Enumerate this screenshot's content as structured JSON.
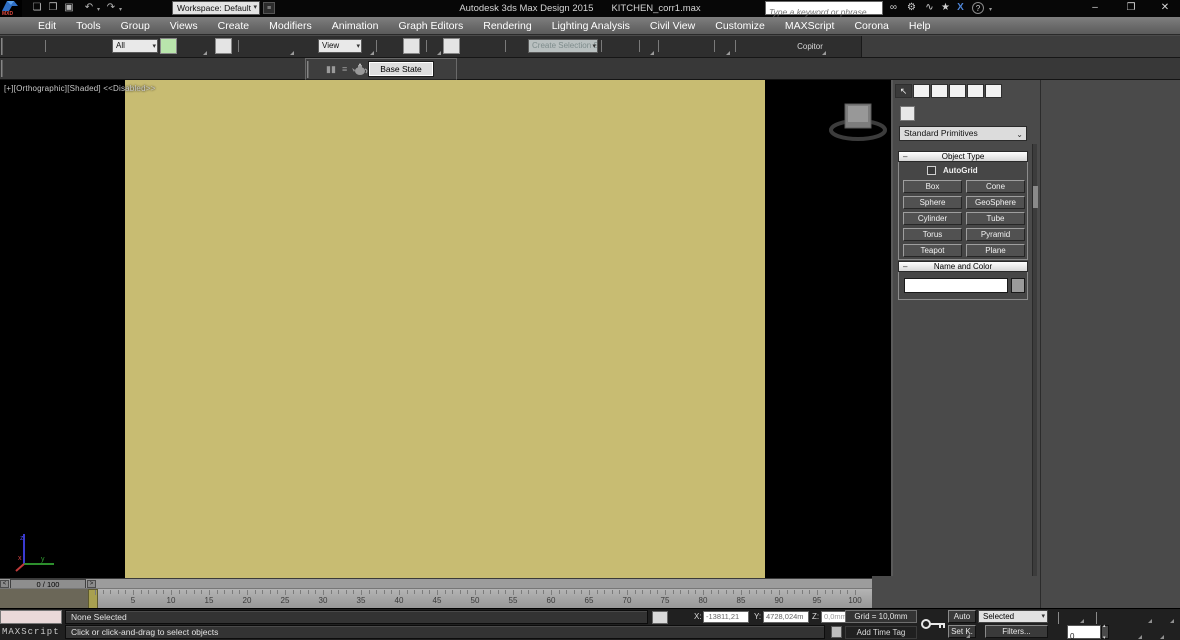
{
  "window": {
    "logo_text": "MXD",
    "workspace_label": "Workspace: Default",
    "app_title": "Autodesk 3ds Max Design 2015",
    "document_title": "KITCHEN_corr1.max",
    "search_placeholder": "Type a keyword or phrase",
    "minimize_glyph": "–",
    "maximize_glyph": "❐",
    "close_glyph": "✕"
  },
  "icons": {
    "new": "❏",
    "open": "❐",
    "save": "▣",
    "undo": "↶",
    "redo": "↷",
    "search_binoculars": "∞",
    "wrench": "⚙",
    "lasso": "∿",
    "star": "★",
    "exchange": "X",
    "help": "?",
    "pause": "▮▮",
    "list": "≡"
  },
  "menu": {
    "items": [
      "Edit",
      "Tools",
      "Group",
      "Views",
      "Create",
      "Modifiers",
      "Animation",
      "Graph Editors",
      "Rendering",
      "Lighting Analysis",
      "Civil View",
      "Customize",
      "MAXScript",
      "Corona",
      "Help"
    ]
  },
  "toolbar": {
    "all_dropdown": "All",
    "view_dropdown": "View",
    "create_selection_dropdown": "Create Selection S",
    "copitor_label": "Copitor"
  },
  "state_toolbar": {
    "base_state_label": "Base State"
  },
  "viewport": {
    "label": "[+][Orthographic][Shaded]  <<Disabled>>",
    "plane_color": "#c8bc72",
    "axis_labels": {
      "x": "x",
      "y": "y",
      "z": "z"
    }
  },
  "command_panel": {
    "tabs": [
      "create",
      "modify",
      "hierarchy",
      "motion",
      "display",
      "utilities"
    ],
    "selected_tab": "create",
    "category_dropdown": "Standard Primitives",
    "object_type": {
      "title": "Object Type",
      "autogrid_label": "AutoGrid",
      "buttons": [
        "Box",
        "Cone",
        "Sphere",
        "GeoSphere",
        "Cylinder",
        "Tube",
        "Torus",
        "Pyramid",
        "Teapot",
        "Plane"
      ]
    },
    "name_color": {
      "title": "Name and Color",
      "name_value": ""
    }
  },
  "timeline": {
    "frame_indicator": "0 / 100",
    "prev_glyph": "<",
    "next_glyph": ">",
    "current_frame": 0,
    "total_frames": 100,
    "tick_labels": [
      "5",
      "10",
      "15",
      "20",
      "25",
      "30",
      "35",
      "40",
      "45",
      "50",
      "55",
      "60",
      "65",
      "70",
      "75",
      "80",
      "85",
      "90",
      "95",
      "100"
    ]
  },
  "status_bar": {
    "maxscript_label": "MAXScript",
    "status_line": "None Selected",
    "prompt_line": "Click or click-and-drag to select objects",
    "coords": {
      "x_label": "X:",
      "x_value": "-13811,21",
      "y_label": "Y:",
      "y_value": "4728,024m",
      "z_label": "Z:",
      "z_value": "0,0mm"
    },
    "grid_label": "Grid = 10,0mm",
    "add_time_tag_label": "Add Time Tag",
    "auto_label": "Auto",
    "set_key_label": "Set K.",
    "selected_dropdown": "Selected",
    "filters_label": "Filters...",
    "frame_spinner_value": "0"
  }
}
